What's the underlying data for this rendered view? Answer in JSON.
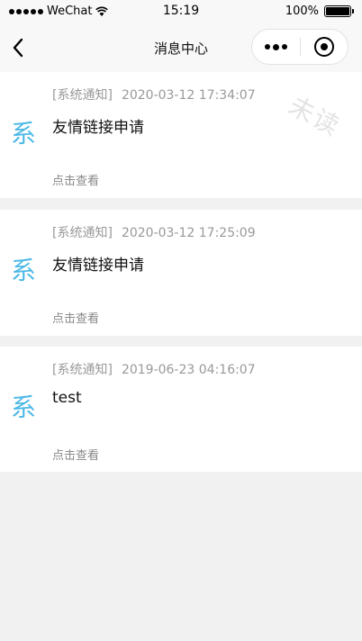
{
  "status_bar": {
    "carrier": "WeChat",
    "time": "15:19",
    "battery": "100%",
    "battery_level": 1.0
  },
  "nav": {
    "title": "消息中心",
    "back_icon": "chevron-left-icon",
    "more_icon": "more-dots-icon",
    "close_icon": "target-close-icon"
  },
  "colors": {
    "accent": "#4cb8e6",
    "background": "#f1f1f1",
    "card": "#ffffff",
    "meta_text": "#999999"
  },
  "messages": [
    {
      "avatar": "系",
      "tag": "[系统通知]",
      "time": "2020-03-12 17:34:07",
      "title": "友情链接申请",
      "link": "点击查看",
      "stamp": "未读"
    },
    {
      "avatar": "系",
      "tag": "[系统通知]",
      "time": "2020-03-12 17:25:09",
      "title": "友情链接申请",
      "link": "点击查看"
    },
    {
      "avatar": "系",
      "tag": "[系统通知]",
      "time": "2019-06-23 04:16:07",
      "title": "test",
      "link": "点击查看"
    }
  ]
}
